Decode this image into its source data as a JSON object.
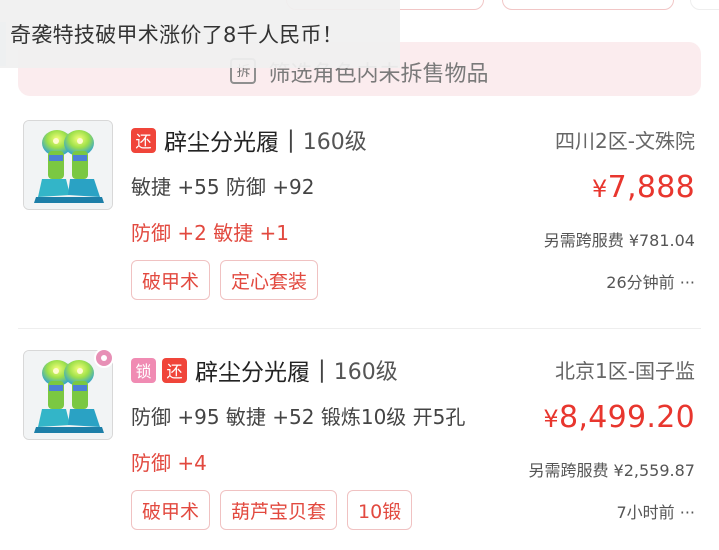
{
  "toast": {
    "message": "奇袭特技破甲术涨价了8千人民币！"
  },
  "filter": {
    "label": "筛选角色内未拆售物品",
    "icon_char": "拆",
    "icon": "filter-split-icon"
  },
  "items": [
    {
      "badges": [
        {
          "text": "还",
          "type": "return"
        }
      ],
      "has_notification_dot": false,
      "name": "辟尘分光履",
      "separator": "|",
      "level": "160级",
      "stats": "敏捷 +55 防御 +92",
      "bonus": "防御 +2 敏捷 +1",
      "tags": [
        "破甲术",
        "定心套装"
      ],
      "server": "四川2区-文殊院",
      "price_symbol": "¥",
      "price": "7,888",
      "fee": "另需跨服费 ¥781.04",
      "time": "26分钟前 ···"
    },
    {
      "badges": [
        {
          "text": "锁",
          "type": "lock"
        },
        {
          "text": "还",
          "type": "return"
        }
      ],
      "has_notification_dot": true,
      "name": "辟尘分光履",
      "separator": "|",
      "level": "160级",
      "stats": "防御 +95 敏捷 +52 锻炼10级 开5孔",
      "bonus": "防御 +4",
      "tags": [
        "破甲术",
        "葫芦宝贝套",
        "10锻"
      ],
      "server": "北京1区-国子监",
      "price_symbol": "¥",
      "price": "8,499.20",
      "fee": "另需跨服费 ¥2,559.87",
      "time": "7小时前 ···"
    }
  ],
  "colors": {
    "accent_red": "#e8362e",
    "badge_return": "#f0453a",
    "badge_lock": "#f08bb3",
    "filter_bg": "#fbecee",
    "tag_border": "#f0c2c2"
  }
}
